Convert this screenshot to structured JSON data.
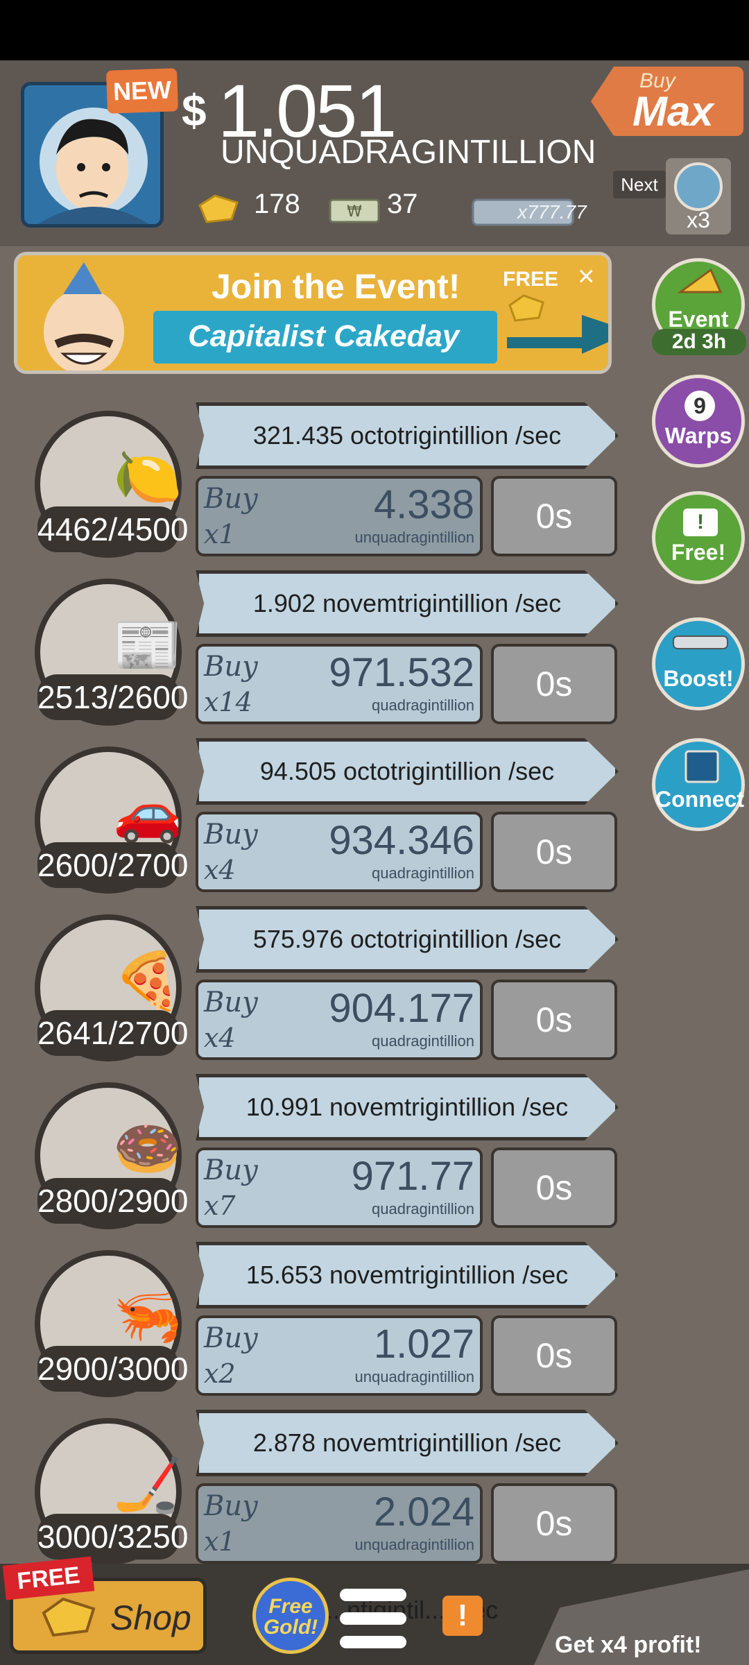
{
  "header": {
    "new_badge": "NEW",
    "currency_symbol": "$",
    "money_value": "1.051",
    "money_unit": "UNQUADRAGINTILLION",
    "gold": "178",
    "megabucks": "37",
    "multiplier": "x777.77",
    "buy_max_small": "Buy",
    "buy_max_big": "Max",
    "next_label": "Next",
    "next_multiplier": "x3"
  },
  "event": {
    "title": "Join the Event!",
    "subtitle": "Capitalist Cakeday",
    "free_tag": "FREE",
    "close": "×",
    "side_label": "Event",
    "timer": "2d 3h"
  },
  "side": {
    "warps_count": "9",
    "warps_label": "Warps",
    "free_label": "Free!",
    "boost_label": "Boost!",
    "connect_label": "Connect"
  },
  "businesses": [
    {
      "icon": "lemon-icon",
      "count": "4462/4500",
      "rate": "321.435 octotrigintillion /sec",
      "buy": "Buy",
      "mult": "x1",
      "cost": "4.338",
      "cost_unit": "unquadragintillion",
      "timer": "0s"
    },
    {
      "icon": "newspaper-icon",
      "count": "2513/2600",
      "rate": "1.902 novemtrigintillion /sec",
      "buy": "Buy",
      "mult": "x14",
      "cost": "971.532",
      "cost_unit": "quadragintillion",
      "timer": "0s"
    },
    {
      "icon": "car-wash-icon",
      "count": "2600/2700",
      "rate": "94.505 octotrigintillion /sec",
      "buy": "Buy",
      "mult": "x4",
      "cost": "934.346",
      "cost_unit": "quadragintillion",
      "timer": "0s"
    },
    {
      "icon": "pizza-icon",
      "count": "2641/2700",
      "rate": "575.976 octotrigintillion /sec",
      "buy": "Buy",
      "mult": "x4",
      "cost": "904.177",
      "cost_unit": "quadragintillion",
      "timer": "0s"
    },
    {
      "icon": "donut-icon",
      "count": "2800/2900",
      "rate": "10.991 novemtrigintillion /sec",
      "buy": "Buy",
      "mult": "x7",
      "cost": "971.77",
      "cost_unit": "quadragintillion",
      "timer": "0s"
    },
    {
      "icon": "shrimp-icon",
      "count": "2900/3000",
      "rate": "15.653 novemtrigintillion /sec",
      "buy": "Buy",
      "mult": "x2",
      "cost": "1.027",
      "cost_unit": "unquadragintillion",
      "timer": "0s"
    },
    {
      "icon": "hockey-icon",
      "count": "3000/3250",
      "rate": "2.878 novemtrigintillion /sec",
      "buy": "Buy",
      "mult": "x1",
      "cost": "2.024",
      "cost_unit": "unquadragintillion",
      "timer": "0s"
    }
  ],
  "bottom": {
    "free_ribbon": "FREE",
    "shop_label": "Shop",
    "free_gold": "Free Gold!",
    "partial_rate": "...ntigintil... /sec",
    "alert": "!",
    "x4_label": "Get x4 profit!"
  }
}
